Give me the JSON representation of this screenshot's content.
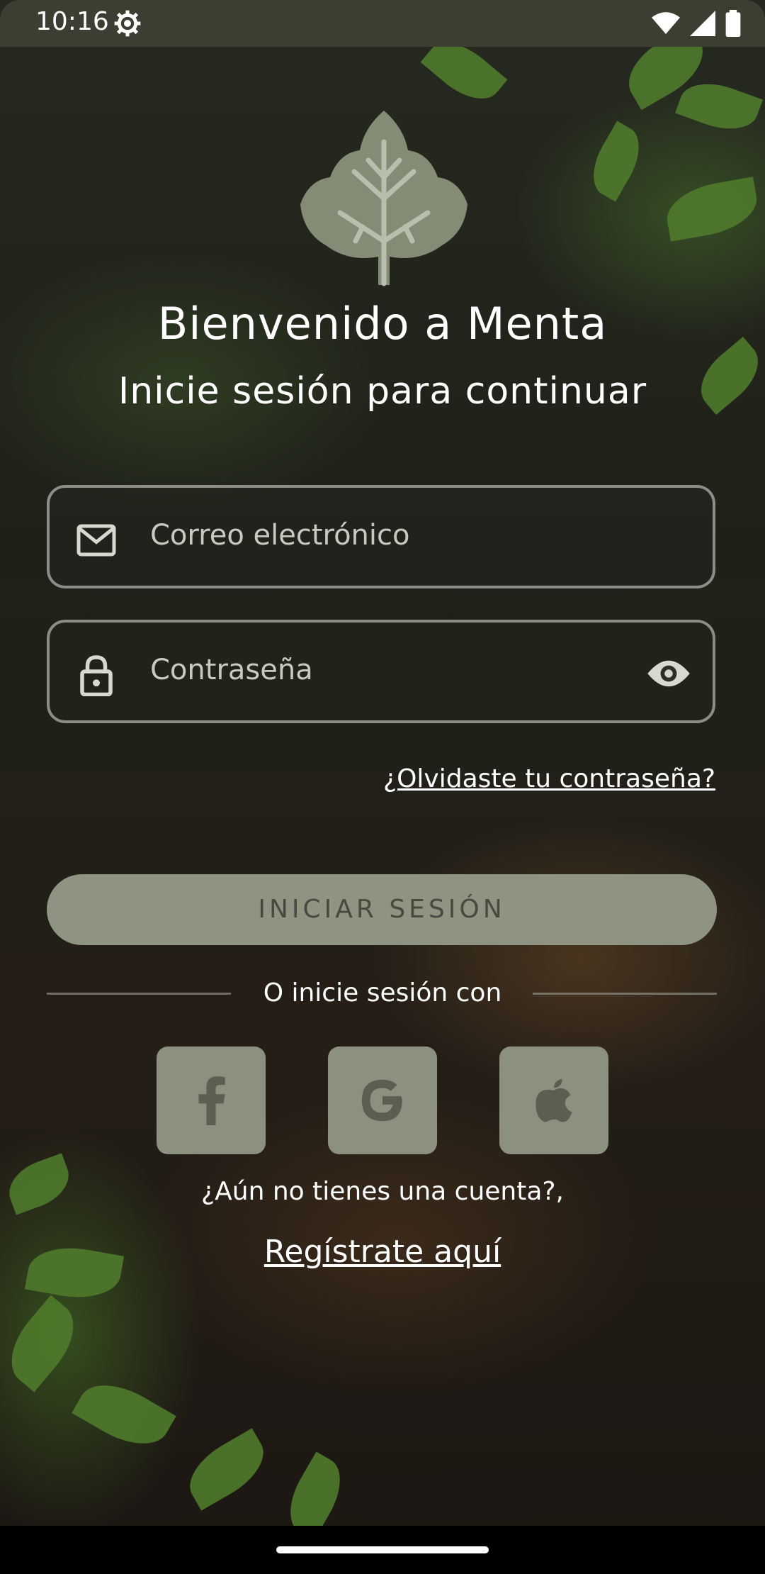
{
  "status_bar": {
    "time": "10:16",
    "icons": [
      "gear-icon",
      "wifi-icon",
      "signal-icon",
      "battery-icon"
    ]
  },
  "header": {
    "title": "Bienvenido a Menta",
    "subtitle": "Inicie sesión para continuar"
  },
  "form": {
    "email_placeholder": "Correo electrónico",
    "password_placeholder": "Contraseña",
    "forgot_label": "¿Olvidaste tu contraseña?",
    "login_label": "INICIAR SESIÓN"
  },
  "social": {
    "divider_text": "O inicie sesión con",
    "providers": [
      "facebook-icon",
      "google-icon",
      "apple-icon"
    ]
  },
  "signup": {
    "prompt": "¿Aún no tienes una cuenta?,",
    "link_label": "Regístrate aquí"
  },
  "colors": {
    "status_bar": "#3b3f31",
    "button_bg": "#8e9481",
    "button_text": "#474a3d",
    "social_bg": "#8b917e"
  }
}
